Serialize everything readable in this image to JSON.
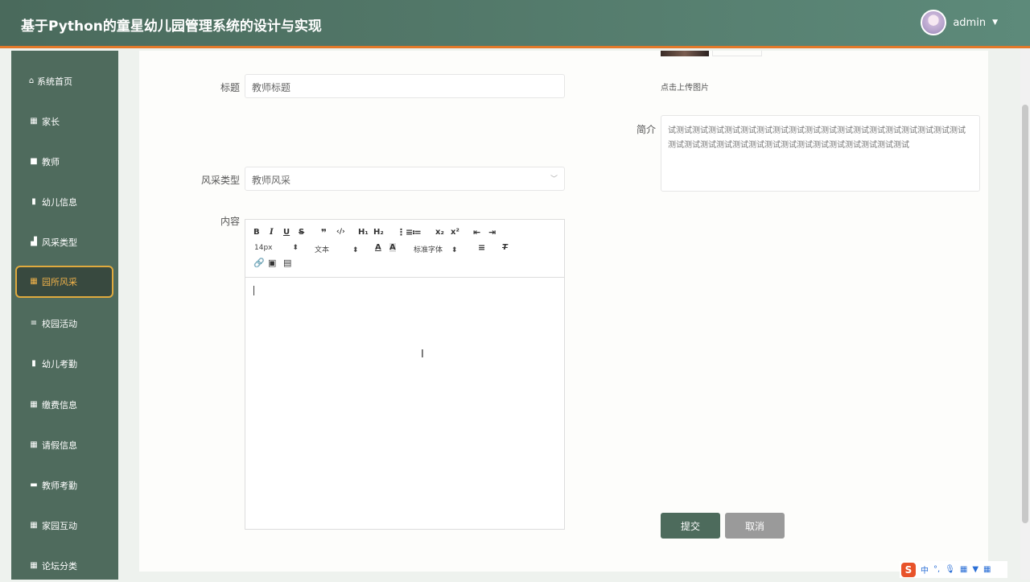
{
  "header": {
    "title": "基于Python的童星幼儿园管理系统的设计与实现",
    "username": "admin"
  },
  "sidebar": {
    "items": [
      {
        "label": "系统首页",
        "icon": "home-icon"
      },
      {
        "label": "家长",
        "icon": "grid-icon"
      },
      {
        "label": "教师",
        "icon": "thumb-icon"
      },
      {
        "label": "幼儿信息",
        "icon": "clipboard-icon"
      },
      {
        "label": "风采类型",
        "icon": "bar-chart-icon"
      },
      {
        "label": "园所风采",
        "icon": "table-icon",
        "active": true
      },
      {
        "label": "校园活动",
        "icon": "list-icon"
      },
      {
        "label": "幼儿考勤",
        "icon": "book-icon"
      },
      {
        "label": "缴费信息",
        "icon": "grid-icon"
      },
      {
        "label": "请假信息",
        "icon": "grid-icon"
      },
      {
        "label": "教师考勤",
        "icon": "print-icon"
      },
      {
        "label": "家园互动",
        "icon": "grid-icon"
      },
      {
        "label": "论坛分类",
        "icon": "grid-icon"
      }
    ]
  },
  "form": {
    "title_label": "标题",
    "title_value": "教师标题",
    "type_label": "风采类型",
    "type_value": "教师风采",
    "content_label": "内容",
    "upload_hint": "点击上传图片",
    "intro_label": "简介",
    "intro_value": "试测试测试测试测试测试测试测试测试测试测试测试测试测试测试测试测试测试测试测试测试测试测试测试测试测试测试测试测试测试测试测试测试测试",
    "submit": "提交",
    "cancel": "取消"
  },
  "editor": {
    "font_size": "14px",
    "text_style": "文本",
    "font_family": "标准字体"
  },
  "ime": {
    "mode": "中"
  }
}
